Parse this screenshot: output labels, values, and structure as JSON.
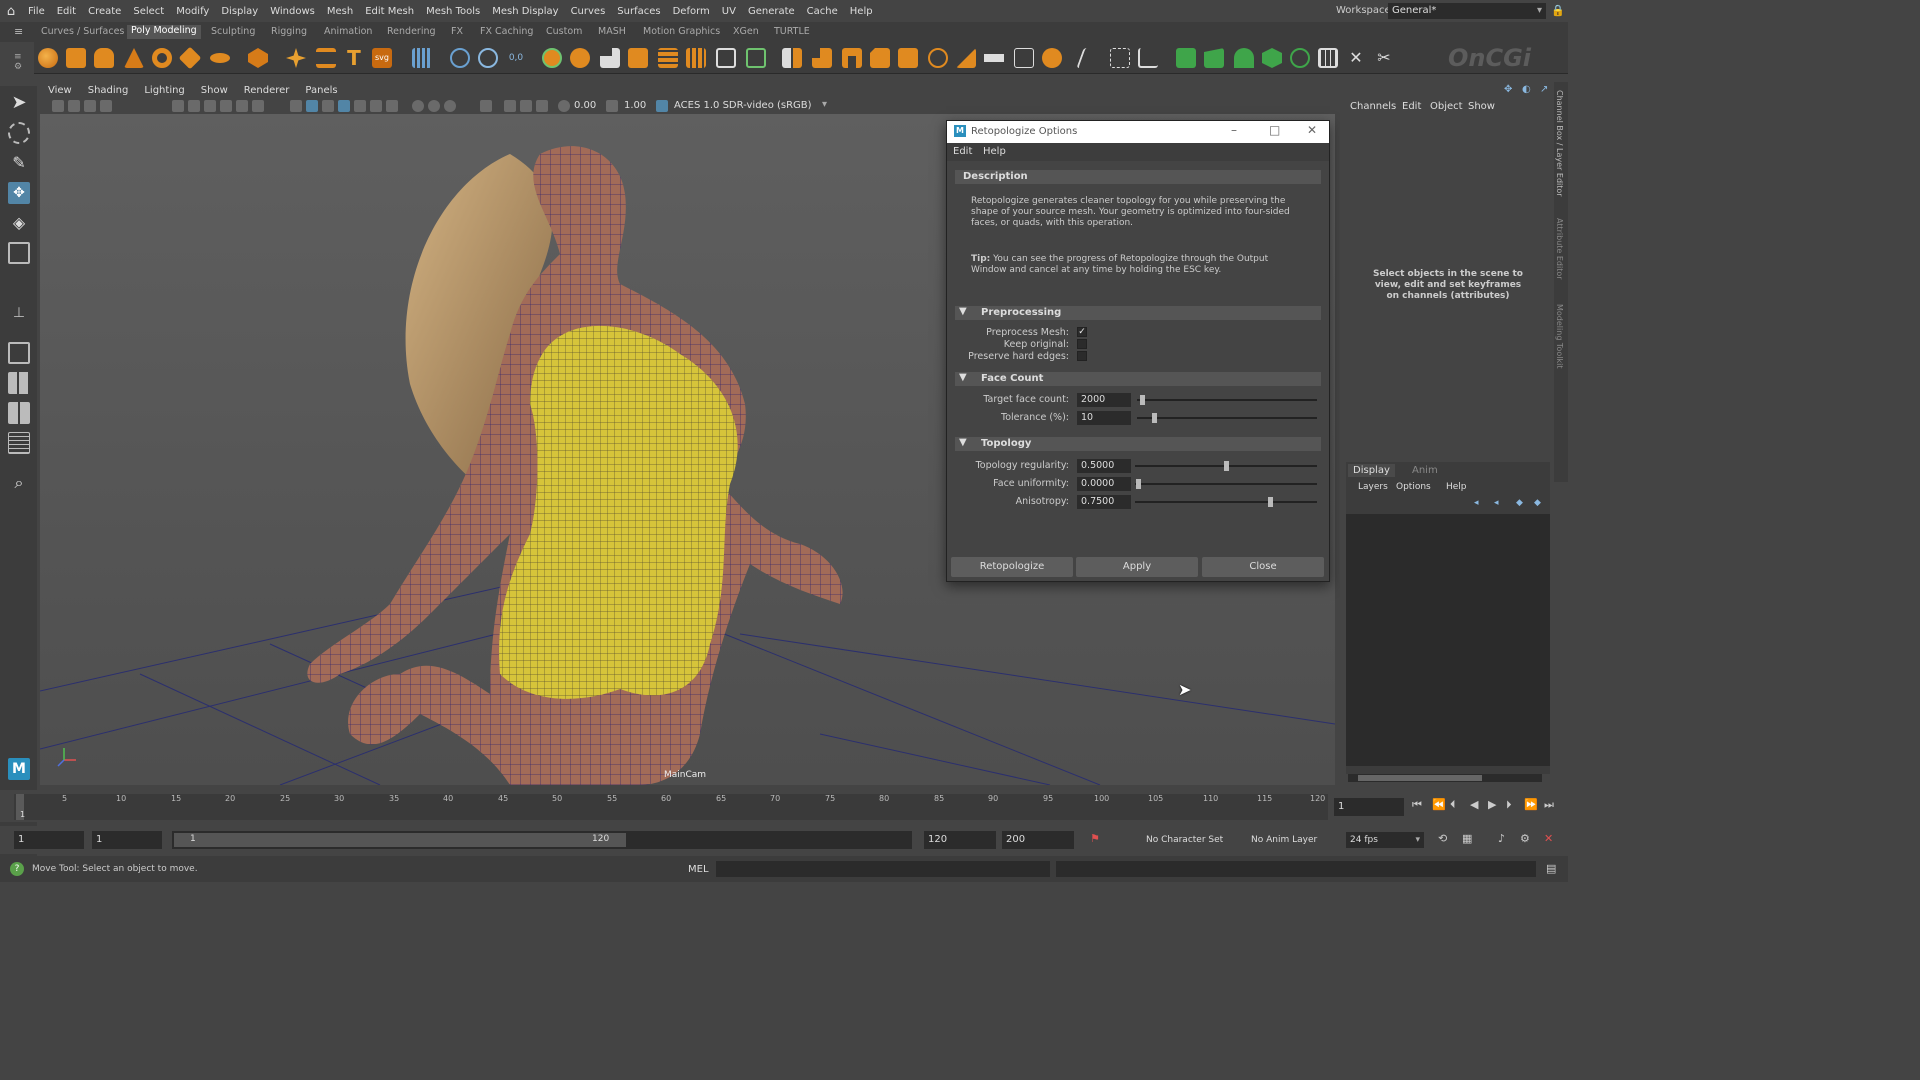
{
  "menubar": {
    "items": [
      "File",
      "Edit",
      "Create",
      "Select",
      "Modify",
      "Display",
      "Windows",
      "Mesh",
      "Edit Mesh",
      "Mesh Tools",
      "Mesh Display",
      "Curves",
      "Surfaces",
      "Deform",
      "UV",
      "Generate",
      "Cache",
      "Help"
    ],
    "workspace_label": "Workspace:",
    "workspace_value": "General*"
  },
  "shelf_tabs": [
    "Curves / Surfaces",
    "Poly Modeling",
    "Sculpting",
    "Rigging",
    "Animation",
    "Rendering",
    "FX",
    "FX Caching",
    "Custom",
    "MASH",
    "Motion Graphics",
    "XGen",
    "TURTLE"
  ],
  "active_shelf_tab": "Poly Modeling",
  "brand_watermark": "OnCGi",
  "viewport": {
    "menu": [
      "View",
      "Shading",
      "Lighting",
      "Show",
      "Renderer",
      "Panels"
    ],
    "value_a": "0.00",
    "value_b": "1.00",
    "color_space": "ACES 1.0 SDR-video (sRGB)",
    "camera_label": "MainCam"
  },
  "dialog": {
    "title": "Retopologize Options",
    "menu": [
      "Edit",
      "Help"
    ],
    "description_header": "Description",
    "description_text": "Retopologize generates cleaner topology for you while preserving the shape of your source mesh. Your geometry is optimized into four-sided faces, or quads, with this operation.",
    "tip_label": "Tip:",
    "tip_text": " You can see the progress of Retopologize through the Output Window and cancel at any time by holding the ESC key.",
    "preprocessing_header": "Preprocessing",
    "preprocess_mesh_label": "Preprocess Mesh:",
    "preprocess_mesh": true,
    "keep_original_label": "Keep original:",
    "keep_original": false,
    "preserve_hard_edges_label": "Preserve hard edges:",
    "preserve_hard_edges": false,
    "face_count_header": "Face Count",
    "target_face_count_label": "Target face count:",
    "target_face_count": "2000",
    "tolerance_label": "Tolerance (%):",
    "tolerance": "10",
    "topology_header": "Topology",
    "topology_regularity_label": "Topology regularity:",
    "topology_regularity": "0.5000",
    "face_uniformity_label": "Face uniformity:",
    "face_uniformity": "0.0000",
    "anisotropy_label": "Anisotropy:",
    "anisotropy": "0.7500",
    "btn_retopologize": "Retopologize",
    "btn_apply": "Apply",
    "btn_close": "Close"
  },
  "channel_box": {
    "menu": [
      "Channels",
      "Edit",
      "Object",
      "Show"
    ],
    "hint": "Select objects in the scene to view, edit and set keyframes on channels (attributes)",
    "layer_tabs": [
      "Display",
      "Anim"
    ],
    "layer_menu": [
      "Layers",
      "Options",
      "Help"
    ],
    "side_tabs": [
      "Channel Box / Layer Editor",
      "Attribute Editor",
      "Modeling Toolkit"
    ]
  },
  "timeline": {
    "ticks": [
      "5",
      "10",
      "15",
      "20",
      "25",
      "30",
      "35",
      "40",
      "45",
      "50",
      "55",
      "60",
      "65",
      "70",
      "75",
      "80",
      "85",
      "90",
      "95",
      "100",
      "105",
      "110",
      "115",
      "120"
    ],
    "first_tick": "1",
    "current_frame": "1"
  },
  "range": {
    "start": "1",
    "anim_start": "1",
    "slider_start": "1",
    "slider_end": "120",
    "anim_end": "120",
    "end": "200",
    "character_set": "No Character Set",
    "anim_layer": "No Anim Layer",
    "fps": "24 fps"
  },
  "status": {
    "help_text": "Move Tool: Select an object to move.",
    "script_lang": "MEL"
  }
}
